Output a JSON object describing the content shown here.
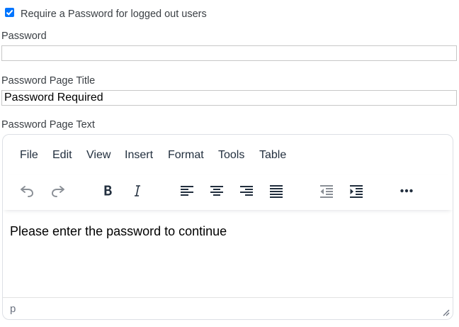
{
  "require_password": {
    "label": "Require a Password for logged out users",
    "checked": true
  },
  "password": {
    "label": "Password",
    "value": ""
  },
  "page_title": {
    "label": "Password Page Title",
    "value": "Password Required"
  },
  "page_text": {
    "label": "Password Page Text",
    "menu": [
      "File",
      "Edit",
      "View",
      "Insert",
      "Format",
      "Tools",
      "Table"
    ],
    "toolbar_icons": [
      "undo-icon",
      "redo-icon",
      "bold-icon",
      "italic-icon",
      "align-left-icon",
      "align-center-icon",
      "align-right-icon",
      "align-justify-icon",
      "outdent-icon",
      "indent-icon",
      "more-icon"
    ],
    "content": "Please enter the password to continue",
    "status_path": "p"
  },
  "colors": {
    "accent": "#0075ff",
    "text": "#222f3e",
    "disabled_icon": "#8a8f96"
  }
}
